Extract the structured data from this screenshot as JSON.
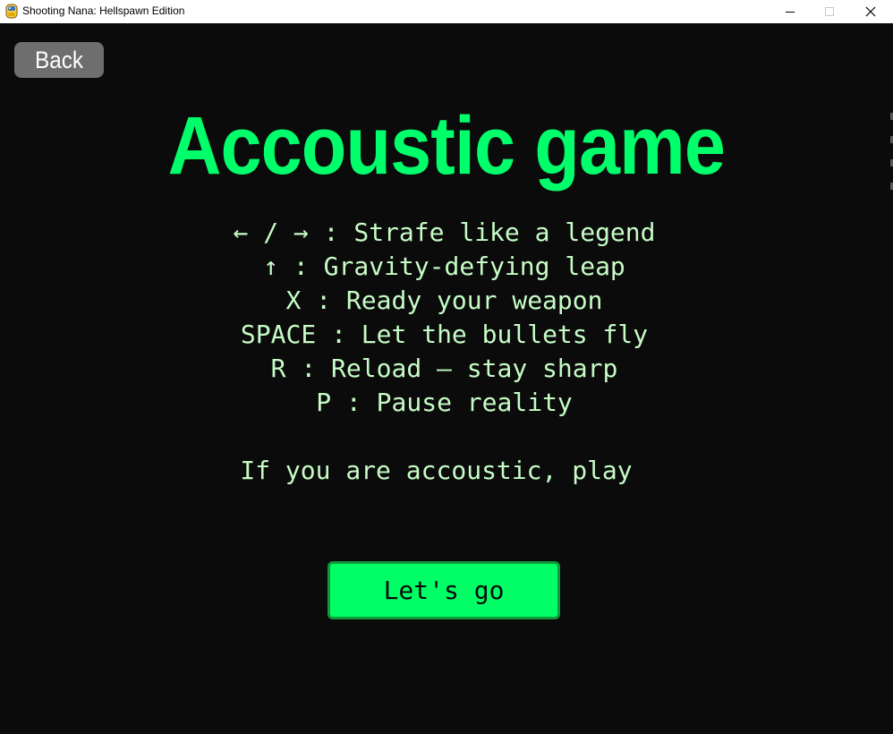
{
  "window": {
    "title": "Shooting Nana: Hellspawn Edition",
    "icon": "python-icon"
  },
  "screen": {
    "back_label": "Back",
    "title": "Accoustic game",
    "controls": [
      "← / → : Strafe like a legend",
      "↑ : Gravity-defying leap",
      "X : Ready your weapon",
      "SPACE : Let the bullets fly",
      "R : Reload — stay sharp",
      "P : Pause reality"
    ],
    "tagline": "If you are accoustic, play",
    "start_label": "Let's go"
  },
  "colors": {
    "background": "#0b0b0b",
    "title": "#00ff6a",
    "text": "#c6fcc6",
    "button": "#00ff66",
    "button_border": "#119a3a",
    "back_button": "#6e6e6e"
  }
}
